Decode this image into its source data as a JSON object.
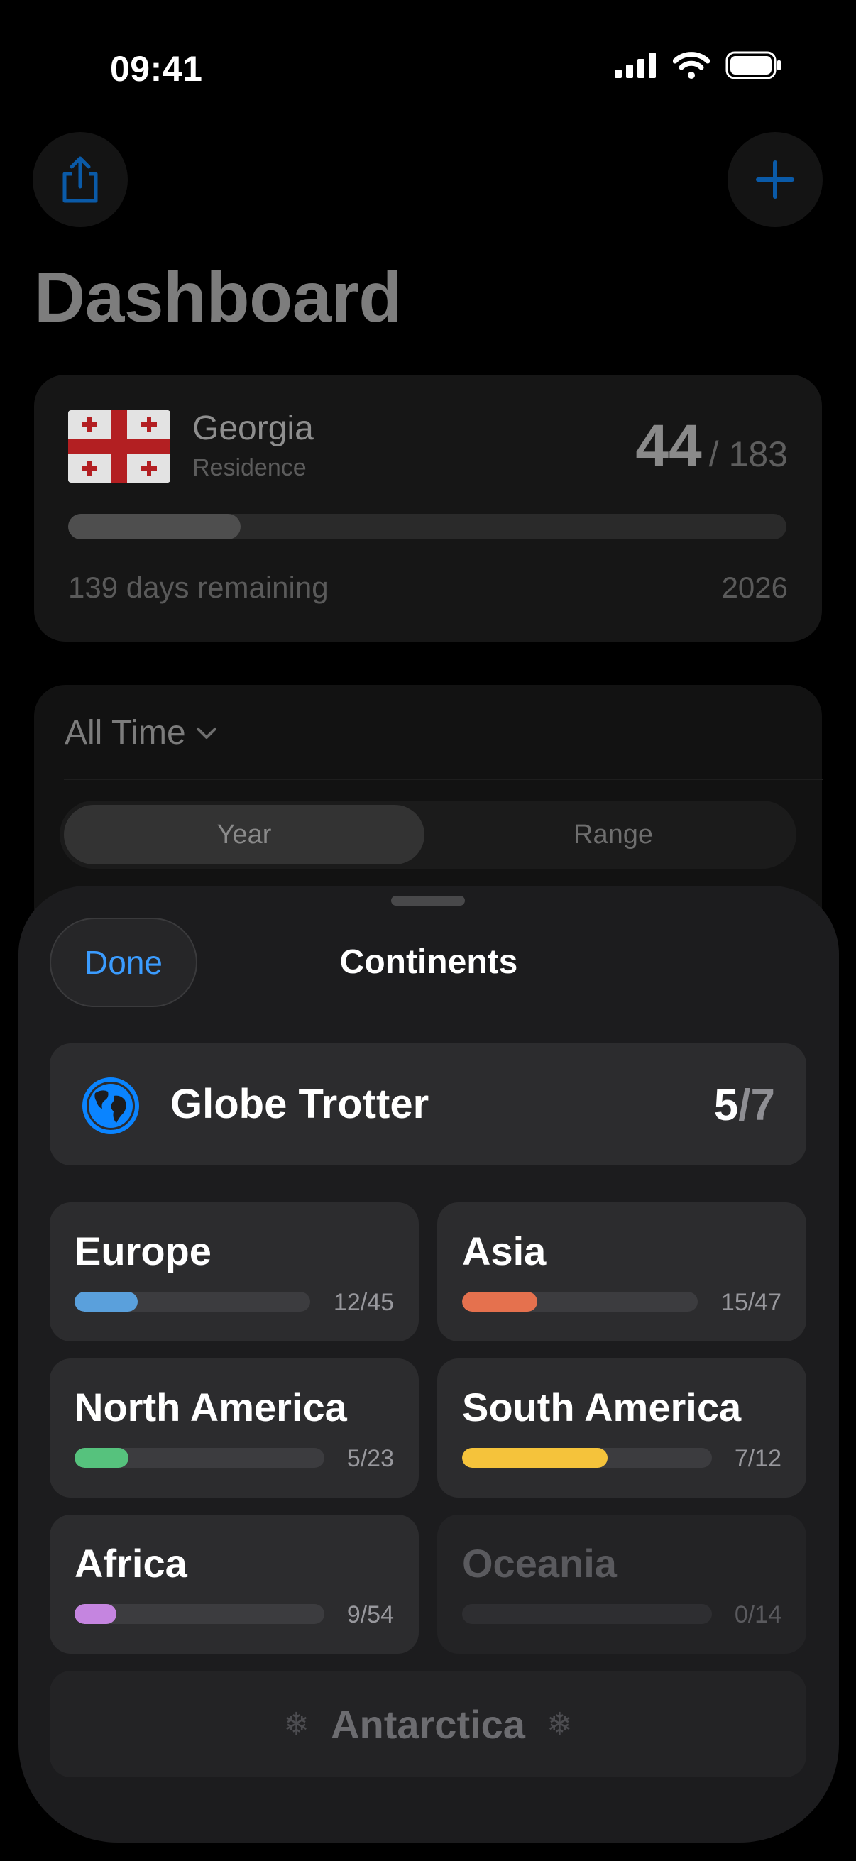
{
  "status_bar": {
    "time": "09:41",
    "icons": [
      "cellular-signal-icon",
      "wifi-icon",
      "battery-icon"
    ]
  },
  "header": {
    "title": "Dashboard",
    "left_button_icon": "share-icon",
    "right_button_icon": "plus-icon",
    "accent_color": "#0a84ff"
  },
  "residence_card": {
    "flag": "georgia-flag",
    "country": "Georgia",
    "type": "Residence",
    "days": "44",
    "limit": "/ 183",
    "progress_fraction": 0.24,
    "remaining": "139 days remaining",
    "year": "2026"
  },
  "period_card": {
    "selected_period": "All Time",
    "segments": [
      "Year",
      "Range"
    ],
    "selected_segment": "Year"
  },
  "sheet": {
    "done_label": "Done",
    "title": "Continents",
    "achievement": {
      "icon": "globe-icon",
      "name": "Globe Trotter",
      "visited": "5",
      "separator": "/",
      "total": "7"
    },
    "continents": [
      {
        "name": "Europe",
        "count": "12/45",
        "progress": 0.267,
        "color": "#5aa0dc"
      },
      {
        "name": "Asia",
        "count": "15/47",
        "progress": 0.319,
        "color": "#e5714e"
      },
      {
        "name": "North America",
        "count": "5/23",
        "progress": 0.217,
        "color": "#56c27d"
      },
      {
        "name": "South America",
        "count": "7/12",
        "progress": 0.583,
        "color": "#f5c33b"
      },
      {
        "name": "Africa",
        "count": "9/54",
        "progress": 0.167,
        "color": "#c585e0"
      },
      {
        "name": "Oceania",
        "count": "0/14",
        "progress": 0,
        "color": "#3c3c3f"
      }
    ],
    "antarctica": {
      "label": "Antarctica",
      "icon": "snowflake-icon"
    }
  }
}
